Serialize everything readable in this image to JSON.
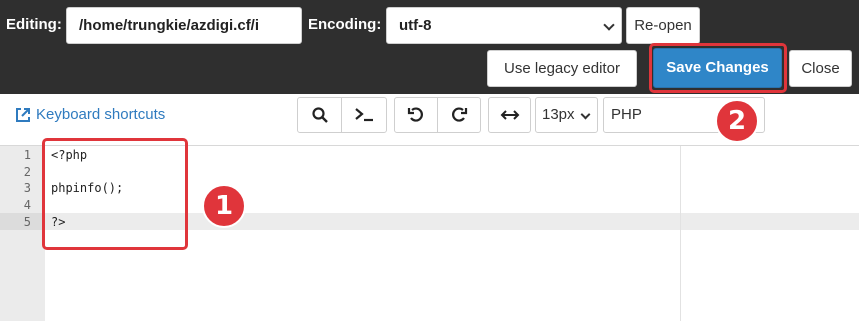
{
  "header": {
    "editing_label": "Editing:",
    "path_value": "/home/trungkie/azdigi.cf/i",
    "encoding_label": "Encoding:",
    "encoding_value": "utf-8",
    "reopen_label": "Re-open",
    "legacy_label": "Use legacy editor",
    "save_label": "Save Changes",
    "close_label": "Close"
  },
  "toolbar": {
    "keyboard_shortcuts": "Keyboard shortcuts",
    "icons": [
      "search-icon",
      "terminal-icon",
      "undo-icon",
      "redo-icon",
      "wrap-icon"
    ],
    "font_size": "13px",
    "language": "PHP"
  },
  "editor": {
    "line_numbers": [
      "1",
      "2",
      "3",
      "4",
      "5"
    ],
    "lines": [
      "<?php",
      "",
      "phpinfo();",
      "",
      "?>"
    ],
    "active_line": 5
  },
  "annotations": {
    "badge1": "1",
    "badge2": "2"
  },
  "colors": {
    "accent": "#2f86c8",
    "highlight": "#e0353b",
    "topbar": "#2f2f2f"
  }
}
